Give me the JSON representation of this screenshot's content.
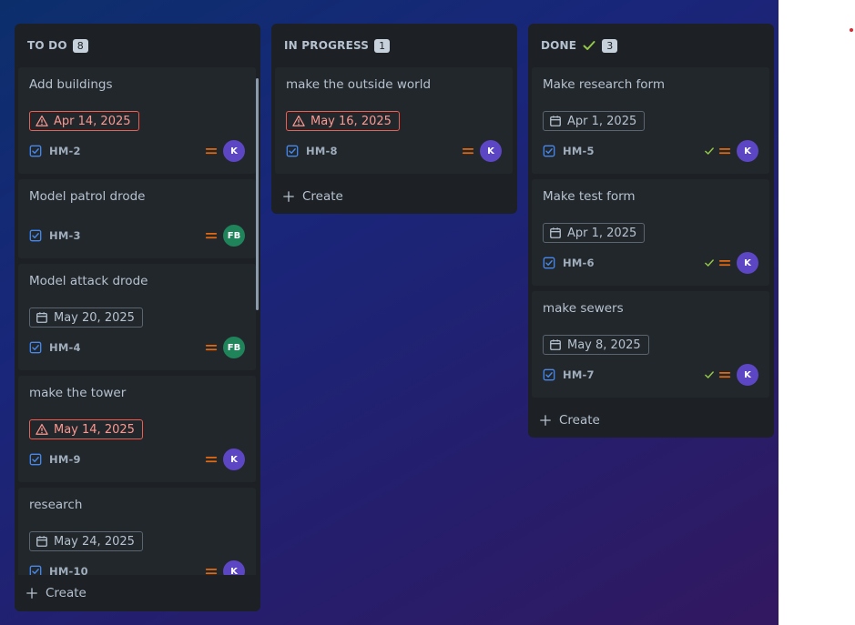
{
  "colors": {
    "board_gradient": [
      "#0c2f6c",
      "#19267a",
      "#231f6e",
      "#321860"
    ],
    "column_bg": "#1d2125",
    "card_bg": "#22272b",
    "overdue": "#f15b50",
    "priority_medium": "#e56910",
    "task_icon": "#4688ec",
    "done_check": "#94c748",
    "avatar_k": "#5c46c4",
    "avatar_fb": "#1f845a"
  },
  "columns": {
    "todo": {
      "title": "TO DO",
      "count": "8",
      "create_label": "Create",
      "cards": [
        {
          "title": "Add buildings",
          "date": "Apr 14, 2025",
          "overdue": true,
          "key": "HM-2",
          "priority": "medium",
          "assignee": "K"
        },
        {
          "title": "Model patrol drode",
          "date": "",
          "overdue": false,
          "key": "HM-3",
          "priority": "medium",
          "assignee": "FB"
        },
        {
          "title": "Model attack drode",
          "date": "May 20, 2025",
          "overdue": false,
          "key": "HM-4",
          "priority": "medium",
          "assignee": "FB"
        },
        {
          "title": "make the tower",
          "date": "May 14, 2025",
          "overdue": true,
          "key": "HM-9",
          "priority": "medium",
          "assignee": "K"
        },
        {
          "title": "research",
          "date": "May 24, 2025",
          "overdue": false,
          "key": "HM-10",
          "priority": "medium",
          "assignee": "K"
        }
      ]
    },
    "in_progress": {
      "title": "IN PROGRESS",
      "count": "1",
      "create_label": "Create",
      "cards": [
        {
          "title": "make the outside world",
          "date": "May 16, 2025",
          "overdue": true,
          "key": "HM-8",
          "priority": "medium",
          "assignee": "K"
        }
      ]
    },
    "done": {
      "title": "DONE",
      "count": "3",
      "create_label": "Create",
      "cards": [
        {
          "title": "Make research form",
          "date": "Apr 1, 2025",
          "overdue": false,
          "key": "HM-5",
          "priority": "medium",
          "assignee": "K"
        },
        {
          "title": "Make test form",
          "date": "Apr 1, 2025",
          "overdue": false,
          "key": "HM-6",
          "priority": "medium",
          "assignee": "K"
        },
        {
          "title": "make sewers",
          "date": "May 8, 2025",
          "overdue": false,
          "key": "HM-7",
          "priority": "medium",
          "assignee": "K"
        }
      ]
    }
  }
}
